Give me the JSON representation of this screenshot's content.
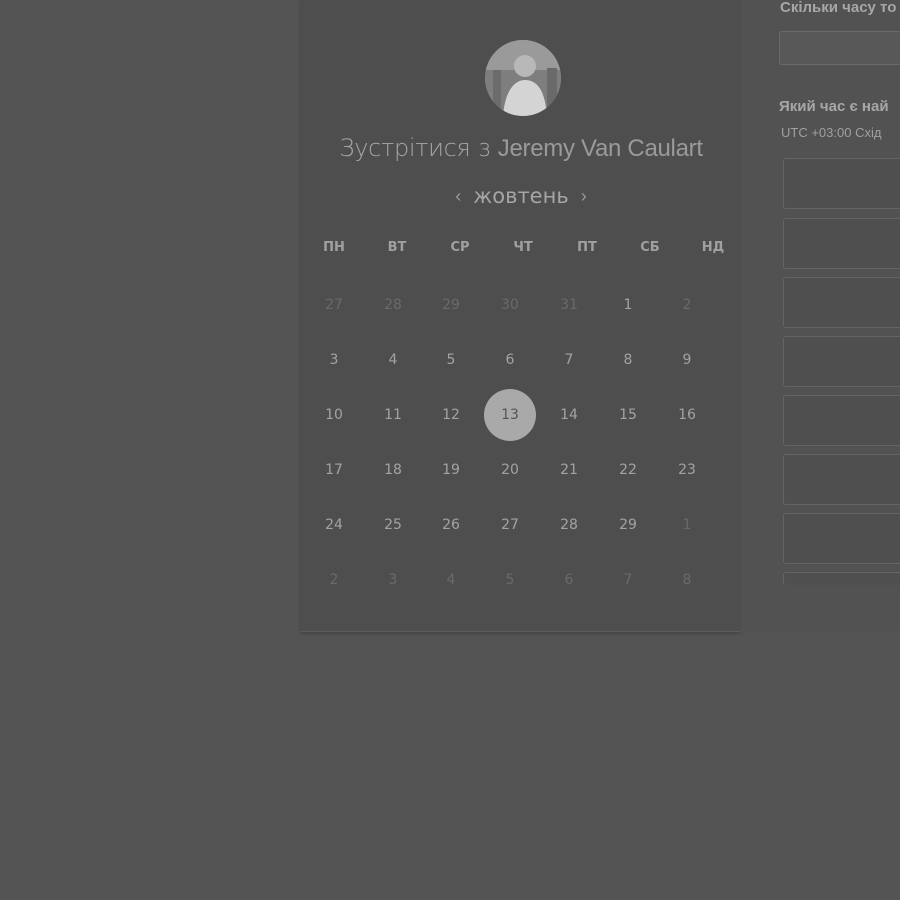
{
  "header": {
    "title_prefix": "Зустрітися з",
    "host_name": "Jeremy Van Caulart"
  },
  "calendar": {
    "month": "жовтень",
    "prev_icon": "‹",
    "next_icon": "›",
    "weekdays": [
      "ПН",
      "ВТ",
      "СР",
      "ЧТ",
      "ПТ",
      "СБ",
      "НД"
    ],
    "weeks": [
      [
        {
          "d": "27",
          "m": true
        },
        {
          "d": "28",
          "m": true
        },
        {
          "d": "29",
          "m": true
        },
        {
          "d": "30",
          "m": true
        },
        {
          "d": "31",
          "m": true
        },
        {
          "d": "1",
          "m": false
        },
        {
          "d": "2",
          "m": true
        }
      ],
      [
        {
          "d": "3",
          "m": false
        },
        {
          "d": "4",
          "m": false
        },
        {
          "d": "5",
          "m": false
        },
        {
          "d": "6",
          "m": false
        },
        {
          "d": "7",
          "m": false
        },
        {
          "d": "8",
          "m": false
        },
        {
          "d": "9",
          "m": false
        }
      ],
      [
        {
          "d": "10",
          "m": false
        },
        {
          "d": "11",
          "m": false
        },
        {
          "d": "12",
          "m": false
        },
        {
          "d": "13",
          "m": false,
          "s": true
        },
        {
          "d": "14",
          "m": false
        },
        {
          "d": "15",
          "m": false
        },
        {
          "d": "16",
          "m": false
        }
      ],
      [
        {
          "d": "17",
          "m": false
        },
        {
          "d": "18",
          "m": false
        },
        {
          "d": "19",
          "m": false
        },
        {
          "d": "20",
          "m": false
        },
        {
          "d": "21",
          "m": false
        },
        {
          "d": "22",
          "m": false
        },
        {
          "d": "23",
          "m": false
        }
      ],
      [
        {
          "d": "24",
          "m": false
        },
        {
          "d": "25",
          "m": false
        },
        {
          "d": "26",
          "m": false
        },
        {
          "d": "27",
          "m": false
        },
        {
          "d": "28",
          "m": false
        },
        {
          "d": "29",
          "m": false
        },
        {
          "d": "1",
          "m": true
        }
      ],
      [
        {
          "d": "2",
          "m": true
        },
        {
          "d": "3",
          "m": true
        },
        {
          "d": "4",
          "m": true
        },
        {
          "d": "5",
          "m": true
        },
        {
          "d": "6",
          "m": true
        },
        {
          "d": "7",
          "m": true
        },
        {
          "d": "8",
          "m": true
        }
      ]
    ]
  },
  "right_panel": {
    "duration_question": "Скільки часу то",
    "time_question": "Який час є най",
    "timezone": "UTC +03:00 Схід"
  }
}
